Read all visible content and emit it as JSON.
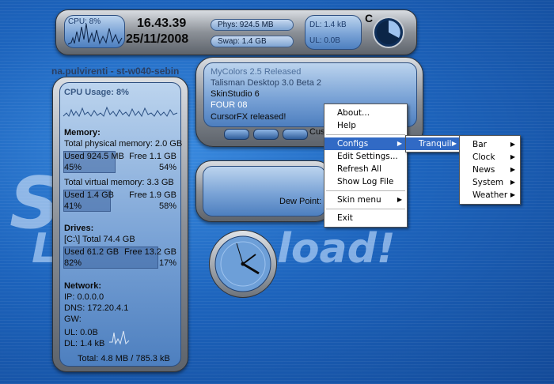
{
  "background": {
    "watermark_mid": "S",
    "watermark_left": "L",
    "watermark_right": "load!"
  },
  "top_bar": {
    "cpu_pill": "CPU: 8%",
    "time": "16.43.39",
    "date": "25/11/2008",
    "phys_pill": "Phys: 924.5 MB",
    "swap_pill": "Swap: 1.4 GB",
    "dl_pill": "DL: 1.4 kB",
    "ul_pill": "UL: 0.0B",
    "drive_letter": "C"
  },
  "user_host": "na.pulvirenti - st-w040-sebin",
  "system_panel": {
    "cpu_usage": "CPU Usage: 8%",
    "memory_heading": "Memory:",
    "phys_total": "Total physical memory: 2.0 GB",
    "phys_used": "Used 924.5 MB",
    "phys_free": "Free 1.1 GB",
    "phys_used_pct": "45%",
    "phys_free_pct": "54%",
    "virt_total": "Total virtual memory: 3.3 GB",
    "virt_used": "Used 1.4 GB",
    "virt_free": "Free 1.9 GB",
    "virt_used_pct": "41%",
    "virt_free_pct": "58%",
    "drives_heading": "Drives:",
    "drive_total": "[C:\\] Total 74.4 GB",
    "drive_used": "Used 61.2 GB",
    "drive_free": "Free 13.2 GB",
    "drive_used_pct": "82%",
    "drive_free_pct": "17%",
    "network_heading": "Network:",
    "ip": "IP:   0.0.0.0",
    "dns": "DNS: 172.20.4.1",
    "gw": "GW:",
    "ul": "UL: 0.0B",
    "dl": "DL: 1.4 kB",
    "total": "Total: 4.8 MB / 785.3 kB"
  },
  "news_panel": {
    "items": [
      "MyColors 2.5 Released",
      "Talisman Desktop 3.0 Beta 2",
      "SkinStudio 6",
      "FOUR 08",
      "CursorFX released!"
    ],
    "cus_button": "Cus"
  },
  "weather_panel": {
    "dew_point": "Dew Point:"
  },
  "context_menu": {
    "items": [
      "About...",
      "Help",
      "Configs",
      "Edit Settings...",
      "Refresh All",
      "Show Log File",
      "Skin menu",
      "Exit"
    ]
  },
  "configs_submenu": {
    "items": [
      "Tranquil"
    ]
  },
  "tranquil_submenu": {
    "items": [
      "Bar",
      "Clock",
      "News",
      "System",
      "Weather"
    ]
  },
  "colors": {
    "menu_highlight": "#316ac5",
    "desktop_blue": "#1f63b5"
  }
}
